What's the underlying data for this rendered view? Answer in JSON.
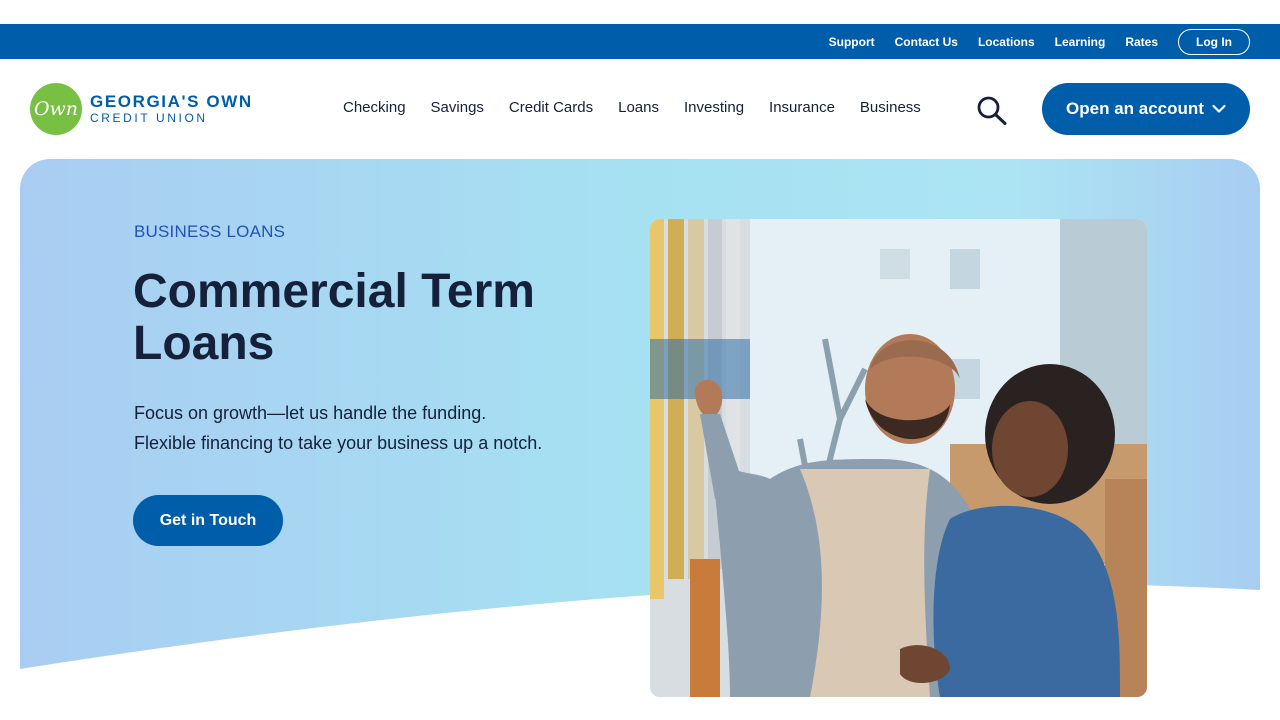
{
  "utility_nav": {
    "links": [
      "Support",
      "Contact Us",
      "Locations",
      "Learning",
      "Rates"
    ],
    "login_label": "Log In"
  },
  "logo": {
    "mark_text": "Own",
    "name": "GEORGIA'S OWN",
    "subtitle": "CREDIT UNION"
  },
  "main_nav": {
    "items": [
      "Checking",
      "Savings",
      "Credit Cards",
      "Loans",
      "Investing",
      "Insurance",
      "Business"
    ],
    "search_icon": "search-icon",
    "open_account_label": "Open an account"
  },
  "hero": {
    "eyebrow": "BUSINESS LOANS",
    "title_line1": "Commercial Term",
    "title_line2": "Loans",
    "desc_line1": "Focus on growth—let us handle the funding.",
    "desc_line2": "Flexible financing to take your business up a notch.",
    "cta_label": "Get in Touch"
  },
  "colors": {
    "brand_blue": "#005daa",
    "logo_green": "#78c043",
    "eyebrow_blue": "#2451b7",
    "hero_bg": "#a6e1f2"
  }
}
